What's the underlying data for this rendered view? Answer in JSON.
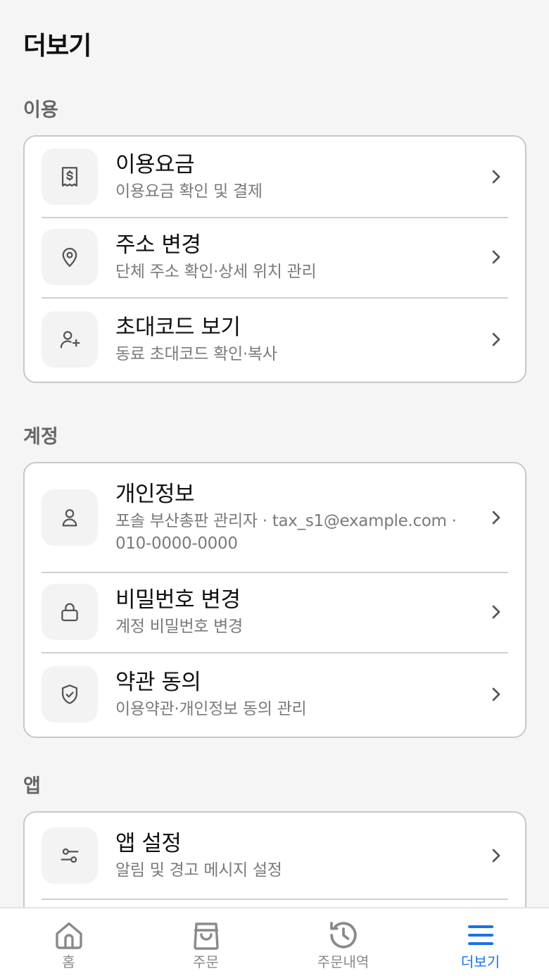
{
  "page": {
    "title": "더보기"
  },
  "sections": [
    {
      "label": "이용",
      "items": [
        {
          "icon": "receipt-dollar-icon",
          "title": "이용요금",
          "subtitle": "이용요금 확인 및 결제"
        },
        {
          "icon": "location-pin-icon",
          "title": "주소 변경",
          "subtitle": "단체 주소 확인·상세 위치 관리"
        },
        {
          "icon": "user-plus-icon",
          "title": "초대코드 보기",
          "subtitle": "동료 초대코드 확인·복사"
        }
      ]
    },
    {
      "label": "계정",
      "items": [
        {
          "icon": "user-icon",
          "title": "개인정보",
          "subtitle": "포솔 부산총판 관리자 · tax_s1@example.com · 010-0000-0000"
        },
        {
          "icon": "lock-icon",
          "title": "비밀번호 변경",
          "subtitle": "계정 비밀번호 변경"
        },
        {
          "icon": "shield-check-icon",
          "title": "약관 동의",
          "subtitle": "이용약관·개인정보 동의 관리"
        }
      ]
    },
    {
      "label": "앱",
      "items": [
        {
          "icon": "sliders-icon",
          "title": "앱 설정",
          "subtitle": "알림 및 경고 메시지 설정"
        }
      ]
    }
  ],
  "tabbar": {
    "active_color": "#1a73e8",
    "inactive_color": "#8a8a8a",
    "tabs": [
      {
        "icon": "home-icon",
        "label": "홈",
        "active": false
      },
      {
        "icon": "shopping-bag-icon",
        "label": "주문",
        "active": false
      },
      {
        "icon": "history-icon",
        "label": "주문내역",
        "active": false
      },
      {
        "icon": "menu-icon",
        "label": "더보기",
        "active": true
      }
    ]
  }
}
